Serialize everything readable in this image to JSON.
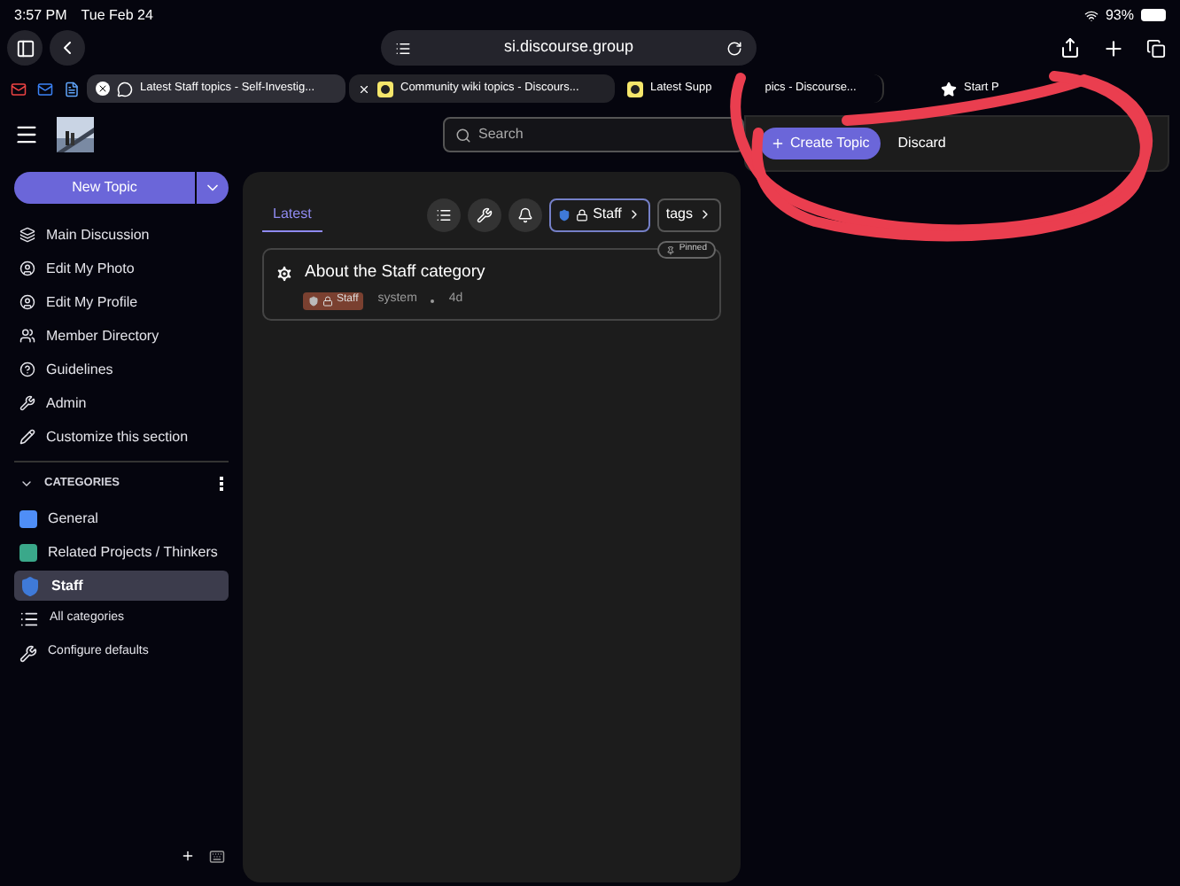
{
  "status_bar": {
    "time": "3:57 PM",
    "date": "Tue Feb 24",
    "battery": "93%"
  },
  "address_bar": {
    "url": "si.discourse.group"
  },
  "browser_tabs": [
    {
      "title": "Latest Staff topics - Self-Investig...",
      "selected": true,
      "kind": "chat"
    },
    {
      "title": "Community wiki topics - Discours...",
      "selected": false,
      "kind": "site"
    },
    {
      "title": "Latest Supp",
      "title_rest": "pics - Discourse...",
      "selected": false,
      "kind": "site"
    },
    {
      "title": "Start P",
      "selected": false,
      "kind": "star"
    }
  ],
  "header": {
    "search_placeholder": "Search"
  },
  "sidebar": {
    "new_topic": "New Topic",
    "items": [
      {
        "label": "Main Discussion",
        "kind": "layers"
      },
      {
        "label": "Edit My Photo",
        "kind": "user"
      },
      {
        "label": "Edit My Profile",
        "kind": "user"
      },
      {
        "label": "Member Directory",
        "kind": "users"
      },
      {
        "label": "Guidelines",
        "kind": "help"
      },
      {
        "label": "Admin",
        "kind": "wrench"
      },
      {
        "label": "Customize this section",
        "kind": "pencil"
      }
    ],
    "categories_heading": "CATEGORIES",
    "categories": [
      {
        "label": "General",
        "color": "#4f8ef7",
        "selected": false,
        "kind": "square"
      },
      {
        "label": "Related Projects / Thinkers",
        "color": "#3aa88a",
        "selected": false,
        "kind": "square"
      },
      {
        "label": "Staff",
        "color": "#3f7ad8",
        "selected": true,
        "kind": "shield"
      },
      {
        "label": "All categories",
        "selected": false,
        "kind": "list"
      },
      {
        "label": "Configure defaults",
        "selected": false,
        "kind": "wrench"
      }
    ]
  },
  "main": {
    "tabs": [
      {
        "label": "Latest",
        "selected": true
      }
    ],
    "category_filter": "Staff",
    "tags_filter": "tags",
    "topics": [
      {
        "title": "About the Staff category",
        "badge": "Pinned",
        "category": "Staff",
        "author": "system",
        "age": "4d"
      }
    ]
  },
  "composer": {
    "create": "Create Topic",
    "discard": "Discard"
  }
}
